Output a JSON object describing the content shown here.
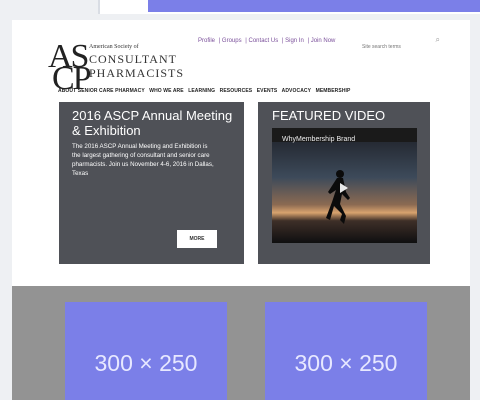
{
  "logo": {
    "monogram_top": "AS",
    "monogram_bottom": "CP",
    "line1": "American Society of",
    "line2": "CONSULTANT",
    "line3": "PHARMACISTS"
  },
  "toplinks": [
    "Profile",
    "Groups",
    "Contact Us",
    "Sign In",
    "Join Now"
  ],
  "search": {
    "placeholder": "Site search terms"
  },
  "nav": [
    "ABOUT SENIOR CARE PHARMACY",
    "WHO WE ARE",
    "LEARNING",
    "RESOURCES",
    "EVENTS",
    "ADVOCACY",
    "MEMBERSHIP"
  ],
  "featured_event": {
    "title": "2016 ASCP Annual Meeting & Exhibition",
    "body": "The 2016 ASCP Annual Meeting and Exhibition is the largest gathering of consultant and senior care pharmacists. Join us November 4-6, 2016 in Dallas, Texas",
    "more_label": "MORE"
  },
  "featured_video": {
    "title": "FEATURED VIDEO",
    "video_title": "WhyMembership Brand"
  },
  "ads": [
    {
      "label": "300 × 250"
    },
    {
      "label": "300 × 250"
    }
  ],
  "colors": {
    "accent_purple": "#7a4f9a",
    "card_gray": "#4f5157",
    "ad_blue": "#7b7fe8",
    "band_gray": "#939393"
  }
}
